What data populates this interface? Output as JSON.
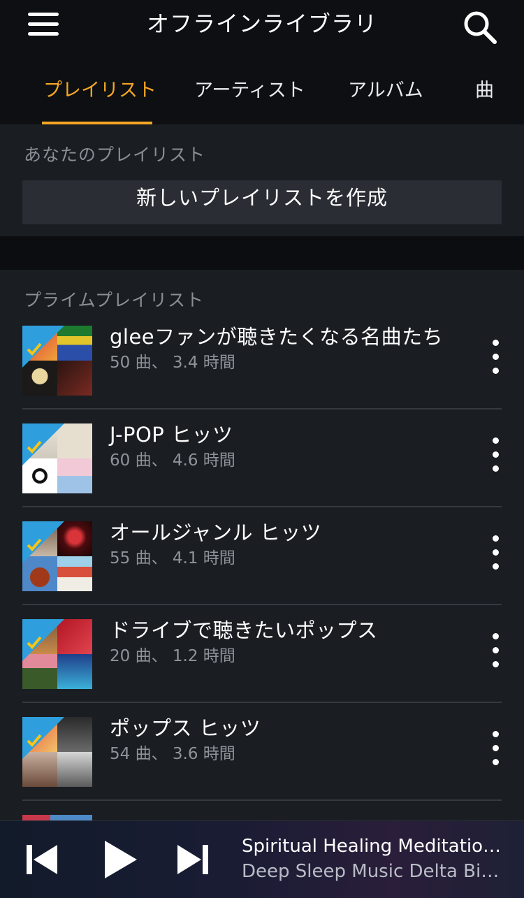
{
  "header": {
    "title": "オフラインライブラリ",
    "menu_icon": "hamburger-menu-icon",
    "search_icon": "search-icon"
  },
  "tabs": [
    {
      "label": "プレイリスト",
      "active": true
    },
    {
      "label": "アーティスト",
      "active": false
    },
    {
      "label": "アルバム",
      "active": false
    },
    {
      "label": "曲",
      "active": false
    }
  ],
  "accent_color": "#f5a623",
  "your_playlists": {
    "section_label": "あなたのプレイリスト",
    "create_button_label": "新しいプレイリストを作成"
  },
  "prime_playlists": {
    "section_label": "プライムプレイリスト",
    "badge_label": "プライム",
    "items": [
      {
        "title": "gleeファンが聴きたくなる名曲たち",
        "meta": "50 曲、 3.4 時間"
      },
      {
        "title": "J-POP ヒッツ",
        "meta": "60 曲、 4.6 時間"
      },
      {
        "title": "オールジャンル ヒッツ",
        "meta": "55 曲、 4.1 時間"
      },
      {
        "title": "ドライブで聴きたいポップス",
        "meta": "20 曲、 1.2 時間"
      },
      {
        "title": "ポップス ヒッツ",
        "meta": "54 曲、 3.6 時間"
      }
    ]
  },
  "player": {
    "track_title": "Spiritual Healing Meditation…",
    "track_artist": "Deep Sleep Music Delta Bin…",
    "controls": [
      "previous-track-icon",
      "play-icon",
      "next-track-icon"
    ]
  }
}
